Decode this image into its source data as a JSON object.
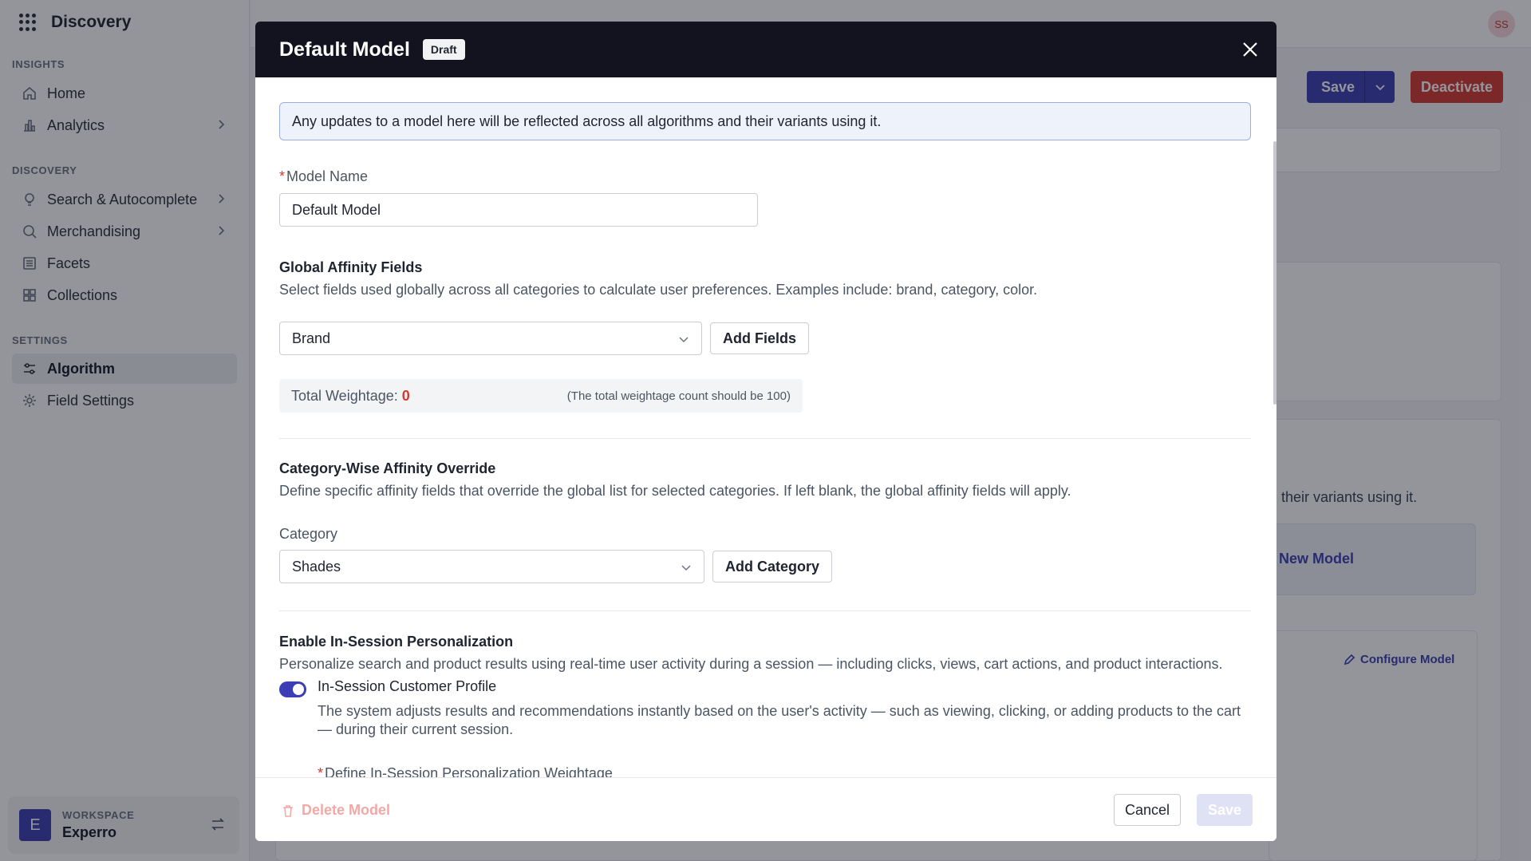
{
  "sidebar": {
    "app_name": "Discovery",
    "sections": [
      {
        "label": "INSIGHTS"
      },
      {
        "label": "DISCOVERY"
      },
      {
        "label": "SETTINGS"
      }
    ],
    "items": [
      {
        "label": "Home",
        "icon": "home-icon"
      },
      {
        "label": "Analytics",
        "icon": "bar-chart-icon"
      },
      {
        "label": "Search & Autocomplete",
        "icon": "bulb-icon"
      },
      {
        "label": "Merchandising",
        "icon": "search-tag-icon"
      },
      {
        "label": "Facets",
        "icon": "list-icon"
      },
      {
        "label": "Collections",
        "icon": "collections-icon"
      },
      {
        "label": "Algorithm",
        "icon": "sliders-icon",
        "active": true
      },
      {
        "label": "Field Settings",
        "icon": "gear-icon"
      }
    ],
    "workspace": {
      "label": "WORKSPACE",
      "name": "Experro",
      "initial": "E"
    }
  },
  "background": {
    "avatar_initials": "SS",
    "save_label": "Save",
    "deactivate_label": "Deactivate",
    "snippet_text": "their variants using it.",
    "new_model_label": "New Model",
    "configure_model_label": "Configure Model"
  },
  "modal": {
    "title": "Default Model",
    "badge": "Draft",
    "info": "Any updates to a model here will be reflected across all algorithms and their variants using it.",
    "model_name_label": "Model Name",
    "model_name_value": "Default Model",
    "global_affinity": {
      "title": "Global Affinity Fields",
      "description": "Select fields used globally across all categories to calculate user preferences. Examples include: brand, category, color.",
      "selected": "Brand",
      "add_label": "Add Fields",
      "total_label": "Total Weightage:",
      "total_value": "0",
      "total_note": "(The total weightage count should be 100)"
    },
    "category_override": {
      "title": "Category-Wise Affinity Override",
      "description": "Define specific affinity fields that override the global list for selected categories. If left blank, the global affinity fields will apply.",
      "category_label": "Category",
      "selected": "Shades",
      "add_label": "Add Category"
    },
    "in_session": {
      "title": "Enable In-Session Personalization",
      "description": "Personalize search and product results using real-time user activity during a session — including clicks, views, cart actions, and product interactions.",
      "toggle_label": "In-Session Customer Profile",
      "toggle_on": true,
      "toggle_description": "The system adjusts results and recommendations instantly based on the user's activity — such as viewing, clicking, or adding products to the cart — during their current session.",
      "weightage_label": "Define In-Session Personalization Weightage"
    },
    "footer": {
      "delete_label": "Delete Model",
      "cancel_label": "Cancel",
      "save_label": "Save"
    }
  },
  "colors": {
    "accent": "#3b3fb3",
    "danger": "#d33a32",
    "header": "#12131f"
  }
}
